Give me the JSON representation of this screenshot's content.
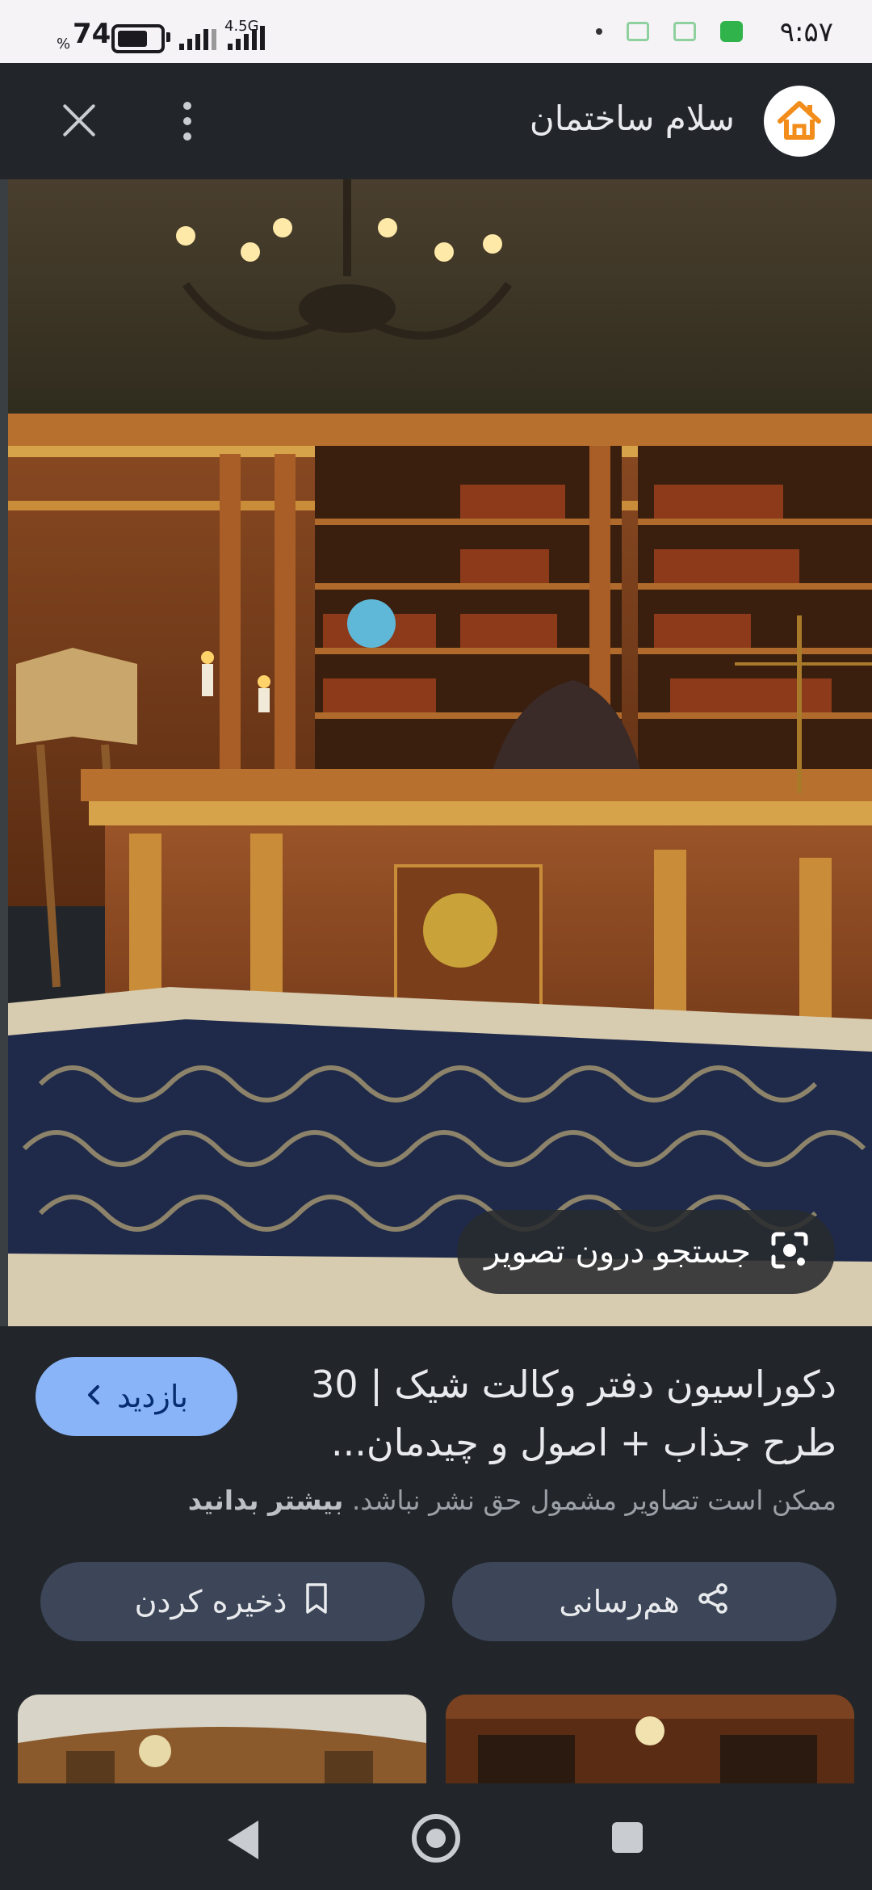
{
  "status_bar": {
    "time": "۹:۵۷",
    "battery_percent": "74",
    "percent_symbol": "%",
    "network_type": "4.5G"
  },
  "header": {
    "site_name": "سلام ساختمان",
    "close_icon": "close-icon",
    "more_icon": "more-vert-icon",
    "logo_icon": "house-logo-icon"
  },
  "image": {
    "lens_search_label": "جستجو درون تصویر",
    "lens_icon": "lens-search-icon"
  },
  "result": {
    "title": "دکوراسیون دفتر وکالت شیک | 30 طرح جذاب + اصول و چیدمان...",
    "visit_label": "بازدید",
    "copyright_notice": "ممکن است تصاویر مشمول حق نشر نباشد.",
    "learn_more": "بیشتر بدانید",
    "share_label": "هم‌رسانی",
    "save_label": "ذخیره کردن",
    "share_icon": "share-icon",
    "save_icon": "bookmark-icon"
  },
  "colors": {
    "background": "#22262b",
    "visit_button": "#8ab4f8",
    "action_button": "#3c4658",
    "logo_orange": "#f28c1a"
  }
}
